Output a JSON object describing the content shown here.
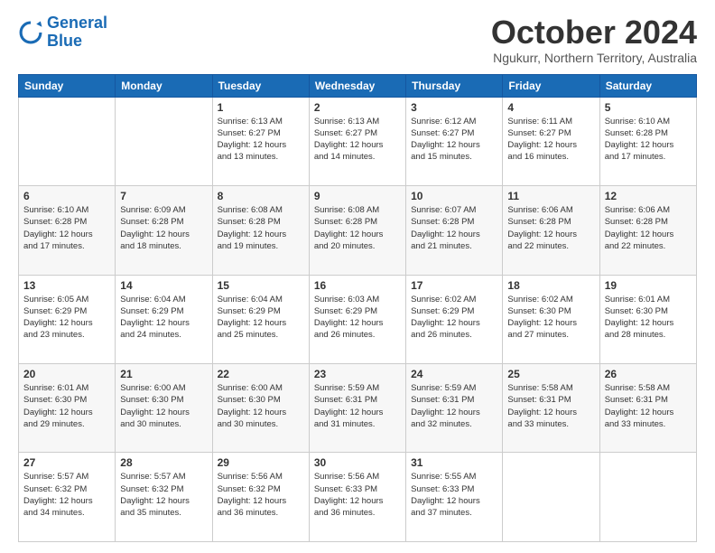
{
  "logo": {
    "line1": "General",
    "line2": "Blue"
  },
  "header": {
    "month": "October 2024",
    "location": "Ngukurr, Northern Territory, Australia"
  },
  "weekdays": [
    "Sunday",
    "Monday",
    "Tuesday",
    "Wednesday",
    "Thursday",
    "Friday",
    "Saturday"
  ],
  "weeks": [
    [
      {
        "day": "",
        "detail": ""
      },
      {
        "day": "",
        "detail": ""
      },
      {
        "day": "1",
        "detail": "Sunrise: 6:13 AM\nSunset: 6:27 PM\nDaylight: 12 hours\nand 13 minutes."
      },
      {
        "day": "2",
        "detail": "Sunrise: 6:13 AM\nSunset: 6:27 PM\nDaylight: 12 hours\nand 14 minutes."
      },
      {
        "day": "3",
        "detail": "Sunrise: 6:12 AM\nSunset: 6:27 PM\nDaylight: 12 hours\nand 15 minutes."
      },
      {
        "day": "4",
        "detail": "Sunrise: 6:11 AM\nSunset: 6:27 PM\nDaylight: 12 hours\nand 16 minutes."
      },
      {
        "day": "5",
        "detail": "Sunrise: 6:10 AM\nSunset: 6:28 PM\nDaylight: 12 hours\nand 17 minutes."
      }
    ],
    [
      {
        "day": "6",
        "detail": "Sunrise: 6:10 AM\nSunset: 6:28 PM\nDaylight: 12 hours\nand 17 minutes."
      },
      {
        "day": "7",
        "detail": "Sunrise: 6:09 AM\nSunset: 6:28 PM\nDaylight: 12 hours\nand 18 minutes."
      },
      {
        "day": "8",
        "detail": "Sunrise: 6:08 AM\nSunset: 6:28 PM\nDaylight: 12 hours\nand 19 minutes."
      },
      {
        "day": "9",
        "detail": "Sunrise: 6:08 AM\nSunset: 6:28 PM\nDaylight: 12 hours\nand 20 minutes."
      },
      {
        "day": "10",
        "detail": "Sunrise: 6:07 AM\nSunset: 6:28 PM\nDaylight: 12 hours\nand 21 minutes."
      },
      {
        "day": "11",
        "detail": "Sunrise: 6:06 AM\nSunset: 6:28 PM\nDaylight: 12 hours\nand 22 minutes."
      },
      {
        "day": "12",
        "detail": "Sunrise: 6:06 AM\nSunset: 6:28 PM\nDaylight: 12 hours\nand 22 minutes."
      }
    ],
    [
      {
        "day": "13",
        "detail": "Sunrise: 6:05 AM\nSunset: 6:29 PM\nDaylight: 12 hours\nand 23 minutes."
      },
      {
        "day": "14",
        "detail": "Sunrise: 6:04 AM\nSunset: 6:29 PM\nDaylight: 12 hours\nand 24 minutes."
      },
      {
        "day": "15",
        "detail": "Sunrise: 6:04 AM\nSunset: 6:29 PM\nDaylight: 12 hours\nand 25 minutes."
      },
      {
        "day": "16",
        "detail": "Sunrise: 6:03 AM\nSunset: 6:29 PM\nDaylight: 12 hours\nand 26 minutes."
      },
      {
        "day": "17",
        "detail": "Sunrise: 6:02 AM\nSunset: 6:29 PM\nDaylight: 12 hours\nand 26 minutes."
      },
      {
        "day": "18",
        "detail": "Sunrise: 6:02 AM\nSunset: 6:30 PM\nDaylight: 12 hours\nand 27 minutes."
      },
      {
        "day": "19",
        "detail": "Sunrise: 6:01 AM\nSunset: 6:30 PM\nDaylight: 12 hours\nand 28 minutes."
      }
    ],
    [
      {
        "day": "20",
        "detail": "Sunrise: 6:01 AM\nSunset: 6:30 PM\nDaylight: 12 hours\nand 29 minutes."
      },
      {
        "day": "21",
        "detail": "Sunrise: 6:00 AM\nSunset: 6:30 PM\nDaylight: 12 hours\nand 30 minutes."
      },
      {
        "day": "22",
        "detail": "Sunrise: 6:00 AM\nSunset: 6:30 PM\nDaylight: 12 hours\nand 30 minutes."
      },
      {
        "day": "23",
        "detail": "Sunrise: 5:59 AM\nSunset: 6:31 PM\nDaylight: 12 hours\nand 31 minutes."
      },
      {
        "day": "24",
        "detail": "Sunrise: 5:59 AM\nSunset: 6:31 PM\nDaylight: 12 hours\nand 32 minutes."
      },
      {
        "day": "25",
        "detail": "Sunrise: 5:58 AM\nSunset: 6:31 PM\nDaylight: 12 hours\nand 33 minutes."
      },
      {
        "day": "26",
        "detail": "Sunrise: 5:58 AM\nSunset: 6:31 PM\nDaylight: 12 hours\nand 33 minutes."
      }
    ],
    [
      {
        "day": "27",
        "detail": "Sunrise: 5:57 AM\nSunset: 6:32 PM\nDaylight: 12 hours\nand 34 minutes."
      },
      {
        "day": "28",
        "detail": "Sunrise: 5:57 AM\nSunset: 6:32 PM\nDaylight: 12 hours\nand 35 minutes."
      },
      {
        "day": "29",
        "detail": "Sunrise: 5:56 AM\nSunset: 6:32 PM\nDaylight: 12 hours\nand 36 minutes."
      },
      {
        "day": "30",
        "detail": "Sunrise: 5:56 AM\nSunset: 6:33 PM\nDaylight: 12 hours\nand 36 minutes."
      },
      {
        "day": "31",
        "detail": "Sunrise: 5:55 AM\nSunset: 6:33 PM\nDaylight: 12 hours\nand 37 minutes."
      },
      {
        "day": "",
        "detail": ""
      },
      {
        "day": "",
        "detail": ""
      }
    ]
  ]
}
